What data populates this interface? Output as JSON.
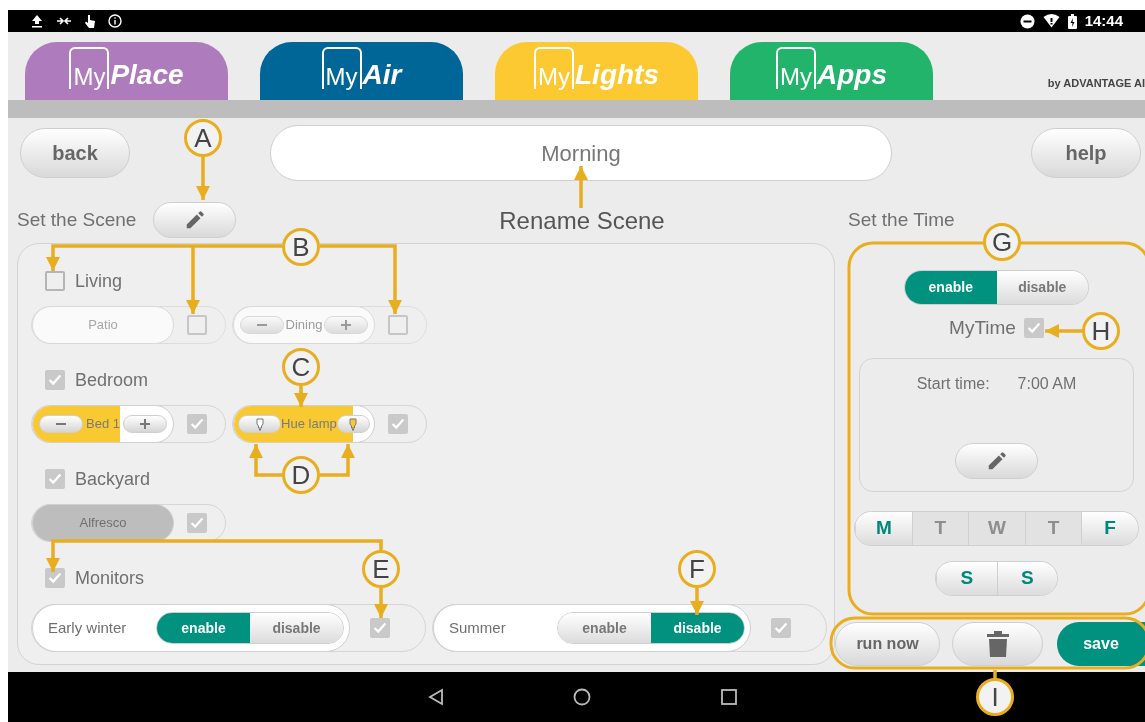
{
  "status_bar": {
    "time": "14:44"
  },
  "app_tabs": [
    {
      "prefix": "My",
      "name": "Place",
      "color": "#ae7bbd"
    },
    {
      "prefix": "My",
      "name": "Air",
      "color": "#006597"
    },
    {
      "prefix": "My",
      "name": "Lights",
      "color": "#fdc933"
    },
    {
      "prefix": "My",
      "name": "Apps",
      "color": "#23b46c"
    }
  ],
  "brand": "by ADVANTAGE AI",
  "header": {
    "back": "back",
    "scene_name": "Morning",
    "help": "help"
  },
  "scene": {
    "title": "Set the Scene",
    "groups": [
      {
        "name": "Living",
        "checked": false,
        "devices": [
          {
            "kind": "switch",
            "name": "Patio",
            "on": false,
            "checked": false
          },
          {
            "kind": "dimmer",
            "name": "Dining",
            "level": 0,
            "checked": false
          }
        ]
      },
      {
        "name": "Bedroom",
        "checked": true,
        "devices": [
          {
            "kind": "dimmer",
            "name": "Bed 1",
            "level": 0.62,
            "checked": true
          },
          {
            "kind": "hue",
            "name": "Hue lamp",
            "level": 0.85,
            "checked": true
          }
        ]
      },
      {
        "name": "Backyard",
        "checked": true,
        "devices": [
          {
            "kind": "switch",
            "name": "Alfresco",
            "on": false,
            "checked": true
          }
        ]
      },
      {
        "name": "Monitors",
        "checked": true,
        "devices": [
          {
            "kind": "toggle",
            "name": "Early winter",
            "checked": true,
            "options": [
              {
                "label": "enable",
                "selected": true
              },
              {
                "label": "disable",
                "selected": false
              }
            ]
          },
          {
            "kind": "toggle",
            "name": "Summer",
            "checked": true,
            "options": [
              {
                "label": "enable",
                "selected": false
              },
              {
                "label": "disable",
                "selected": true
              }
            ]
          }
        ]
      }
    ]
  },
  "time": {
    "title": "Set the Time",
    "options": [
      {
        "label": "enable",
        "selected": true
      },
      {
        "label": "disable",
        "selected": false
      }
    ],
    "mytime": {
      "label": "MyTime",
      "checked": true
    },
    "start_label": "Start time:",
    "start_value": "7:00 AM",
    "days": [
      {
        "label": "M",
        "selected": true
      },
      {
        "label": "T",
        "selected": false
      },
      {
        "label": "W",
        "selected": false
      },
      {
        "label": "T",
        "selected": false
      },
      {
        "label": "F",
        "selected": true
      }
    ],
    "weekend": [
      {
        "label": "S",
        "selected": true
      },
      {
        "label": "S",
        "selected": true
      }
    ]
  },
  "actions": {
    "run_now": "run now",
    "save": "save"
  },
  "annotations": {
    "rename": "Rename Scene",
    "callouts": [
      {
        "label": "A"
      },
      {
        "label": "B"
      },
      {
        "label": "C"
      },
      {
        "label": "D"
      },
      {
        "label": "E"
      },
      {
        "label": "F"
      },
      {
        "label": "G"
      },
      {
        "label": "H"
      },
      {
        "label": "I"
      }
    ]
  }
}
